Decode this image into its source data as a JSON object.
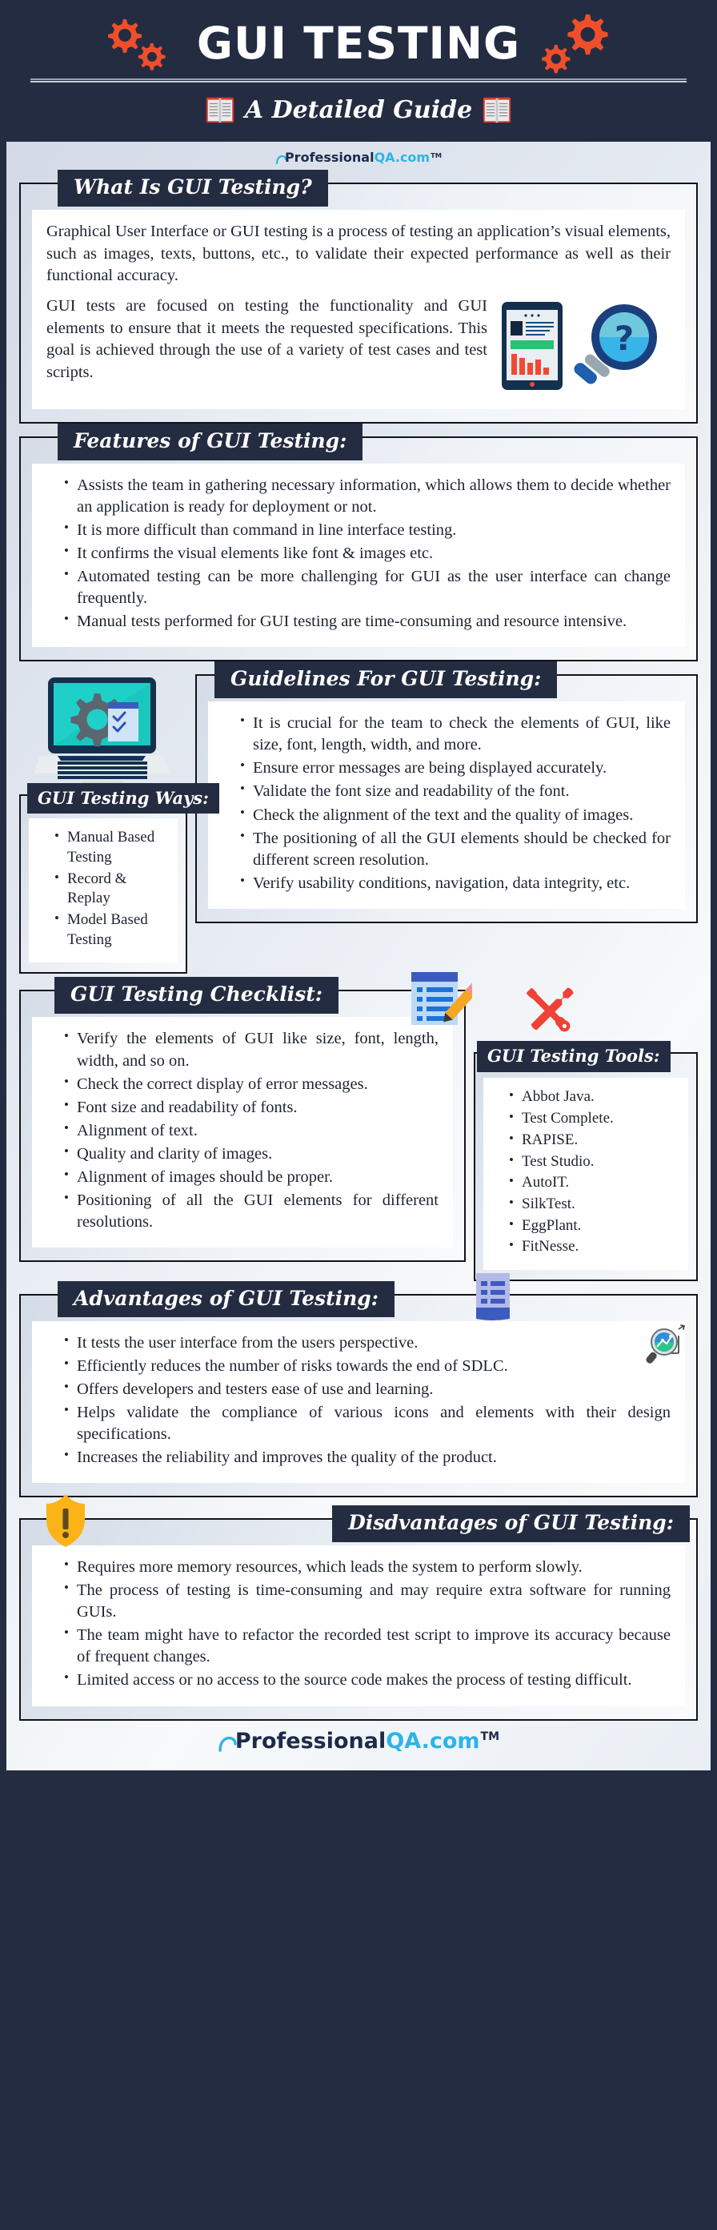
{
  "header": {
    "title": "GUI TESTING",
    "subtitle": "A Detailed Guide",
    "gear_color": "#ef4e2b",
    "bg_color": "#242c41"
  },
  "brand": {
    "name_dark": "Professional",
    "name_cyan": "QA.com",
    "tm": "TM",
    "dark_color": "#1d2b4a",
    "cyan_color": "#2cb4e8"
  },
  "sections": {
    "what_is": {
      "title": "What Is GUI Testing?",
      "para1": "Graphical User Interface or GUI testing is a process of testing an application’s visual elements, such as images, texts, buttons, etc., to validate their expected performance as well as their functional accuracy.",
      "para2": "GUI tests are focused on testing the functionality and GUI elements to ensure that it meets the requested specifications. This goal is achieved through the use of a variety of test cases and test scripts."
    },
    "features": {
      "title": "Features of GUI Testing:",
      "items": [
        "Assists the team in gathering necessary information, which allows them to decide whether an application is ready for deployment or not.",
        "It is more difficult than command in line interface testing.",
        "It confirms the visual elements like font & images etc.",
        "Automated testing can be more challenging for GUI as the user interface can change frequently.",
        "Manual tests performed for GUI testing are time-consuming and resource intensive."
      ]
    },
    "guidelines": {
      "title": "Guidelines For GUI Testing:",
      "items": [
        "It is crucial for the team to check the elements of GUI, like size, font, length, width, and more.",
        "Ensure error messages are being displayed accurately.",
        "Validate the font size and readability of the font.",
        "Check the alignment of the text and the quality of images.",
        "The positioning of all the GUI elements should be checked for different screen resolution.",
        "Verify usability conditions, navigation, data integrity, etc."
      ]
    },
    "ways": {
      "title": "GUI Testing Ways:",
      "items": [
        "Manual Based Testing",
        "Record & Replay",
        "Model Based Testing"
      ]
    },
    "checklist": {
      "title": "GUI Testing Checklist:",
      "items": [
        "Verify the elements of GUI like size, font, length, width, and so on.",
        "Check the correct display of error messages.",
        "Font size and readability of fonts.",
        "Alignment of text.",
        "Quality and clarity of images.",
        "Alignment of images should be proper.",
        "Positioning of all the GUI elements for different resolutions."
      ]
    },
    "tools": {
      "title": "GUI Testing Tools:",
      "items": [
        "Abbot Java.",
        "Test Complete.",
        "RAPISE.",
        "Test Studio.",
        "AutoIT.",
        "SilkTest.",
        "EggPlant.",
        "FitNesse."
      ]
    },
    "advantages": {
      "title": "Advantages of GUI Testing:",
      "items": [
        "It tests the user interface from the users perspective.",
        "Efficiently reduces the number of risks towards the end of SDLC.",
        "Offers developers and testers ease of use and learning.",
        "Helps validate the compliance of various icons and elements with their design specifications.",
        "Increases the reliability and improves the quality of the product."
      ]
    },
    "disadvantages": {
      "title": "Disdvantages of GUI Testing:",
      "items": [
        "Requires more memory resources, which leads the system to perform slowly.",
        "The process of testing is time-consuming and may require extra software for running GUIs.",
        "The team might have to refactor the recorded test script to improve its accuracy because of frequent changes.",
        "Limited access or no access to the source code makes the process of testing difficult."
      ]
    }
  }
}
